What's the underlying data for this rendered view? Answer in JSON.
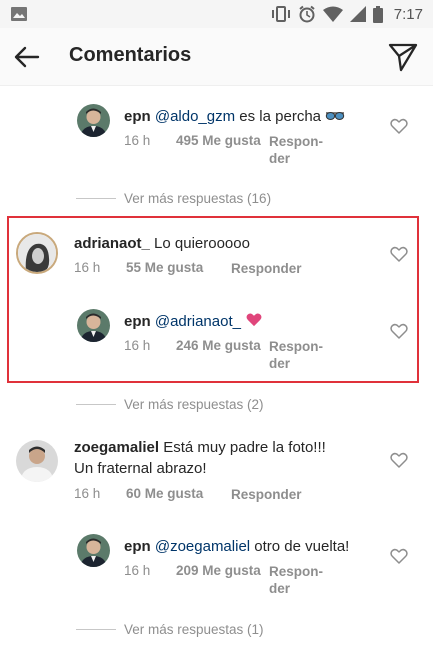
{
  "status_bar": {
    "time": "7:17"
  },
  "header": {
    "title": "Comentarios"
  },
  "comments": [
    {
      "user": "epn",
      "mention": "@aldo_gzm",
      "text": " es la percha ",
      "time": "16 h",
      "likes": "495 Me gusta",
      "reply_1": "Respon-",
      "reply_2": "der"
    },
    {
      "more": "Ver más respuestas (16)"
    },
    {
      "user": "adrianaot_",
      "text": " Lo quierooooo",
      "time": "16 h",
      "likes": "55 Me gusta",
      "reply": "Responder"
    },
    {
      "user": "epn",
      "mention": "@adrianaot_",
      "time": "16 h",
      "likes": "246 Me gusta",
      "reply_1": "Respon-",
      "reply_2": "der"
    },
    {
      "more": "Ver más respuestas (2)"
    },
    {
      "user": "zoegamaliel",
      "text": " Está muy padre la foto!!!",
      "text2": "Un fraternal abrazo!",
      "time": "16 h",
      "likes": "60 Me gusta",
      "reply": "Responder"
    },
    {
      "user": "epn",
      "mention": "@zoegamaliel",
      "text": " otro de vuelta!",
      "time": "16 h",
      "likes": "209 Me gusta",
      "reply_1": "Respon-",
      "reply_2": "der"
    },
    {
      "more": "Ver más respuestas (1)"
    }
  ],
  "colors": {
    "highlight": "#e0313a",
    "mention": "#003569",
    "heart_emoji": "#e0457b"
  },
  "icons": [
    "gallery-icon",
    "vibrate-icon",
    "alarm-icon",
    "wifi-icon",
    "signal-icon",
    "battery-icon",
    "back-arrow-icon",
    "send-icon",
    "heart-icon",
    "sunglasses-emoji",
    "pink-heart-emoji"
  ]
}
